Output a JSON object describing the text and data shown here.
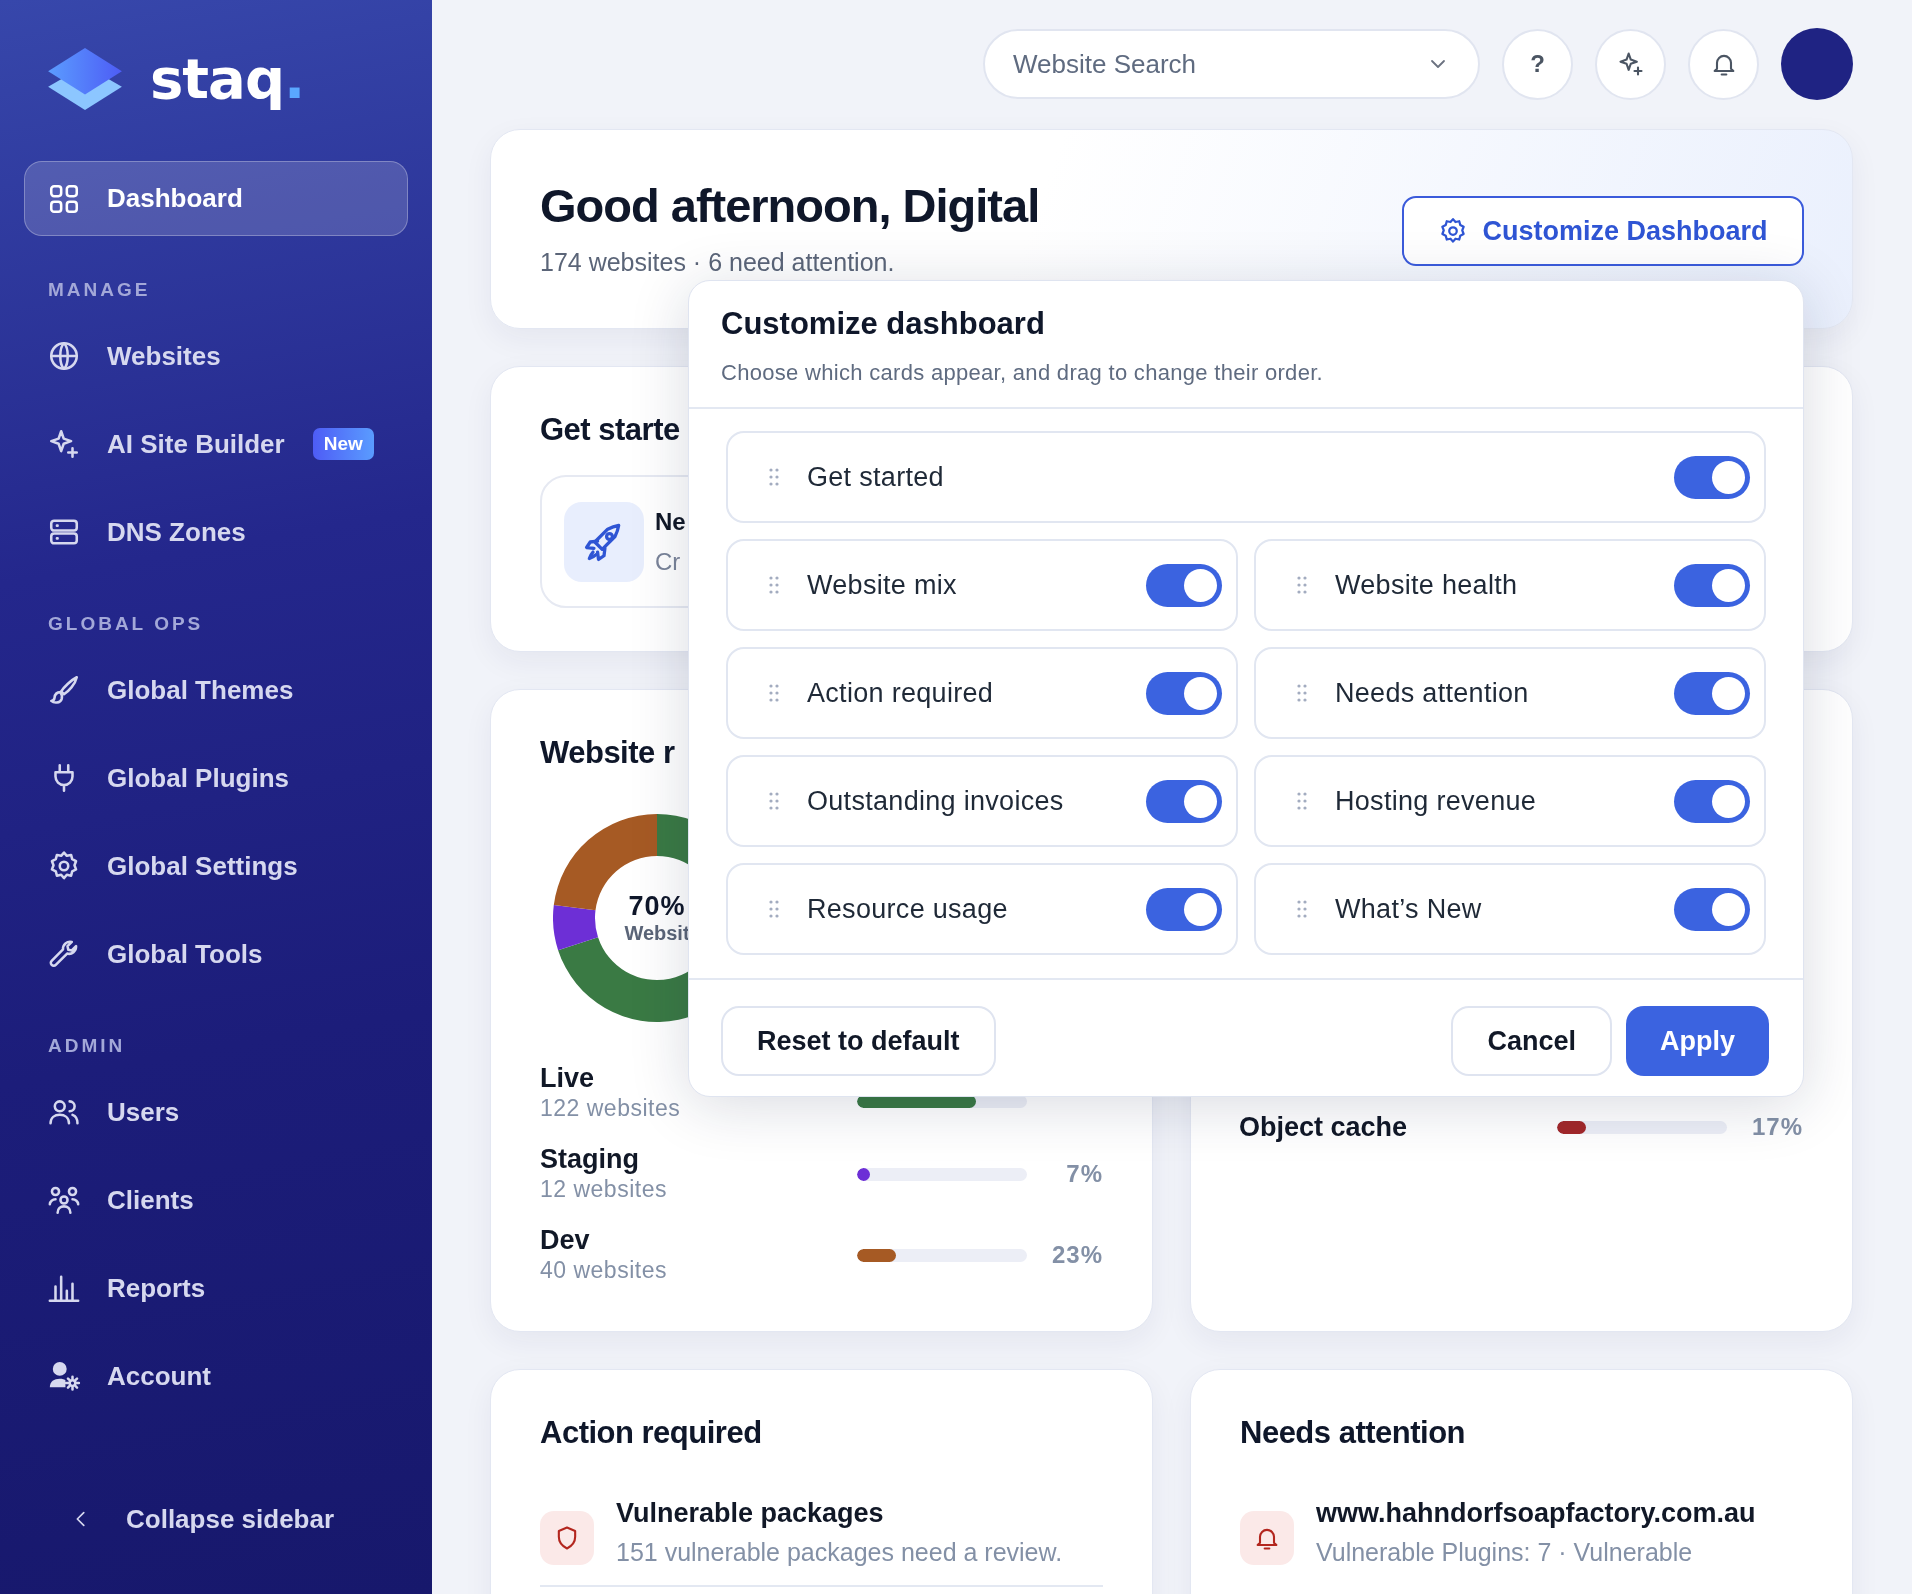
{
  "sidebar": {
    "brand": "staq",
    "brand_dot": ".",
    "nav": [
      {
        "kind": "item",
        "label": "Dashboard",
        "selected": true
      },
      {
        "kind": "section",
        "label": "MANAGE"
      },
      {
        "kind": "item",
        "label": "Websites",
        "selected": false
      },
      {
        "kind": "item",
        "label": "AI Site Builder",
        "selected": false,
        "badge": "New"
      },
      {
        "kind": "item",
        "label": "DNS Zones",
        "selected": false
      },
      {
        "kind": "section",
        "label": "GLOBAL OPS"
      },
      {
        "kind": "item",
        "label": "Global Themes",
        "selected": false
      },
      {
        "kind": "item",
        "label": "Global Plugins",
        "selected": false
      },
      {
        "kind": "item",
        "label": "Global Settings",
        "selected": false
      },
      {
        "kind": "item",
        "label": "Global Tools",
        "selected": false
      },
      {
        "kind": "section",
        "label": "ADMIN"
      },
      {
        "kind": "item",
        "label": "Users",
        "selected": false
      },
      {
        "kind": "item",
        "label": "Clients",
        "selected": false
      },
      {
        "kind": "item",
        "label": "Reports",
        "selected": false
      },
      {
        "kind": "item",
        "label": "Account",
        "selected": false
      }
    ],
    "collapse": "Collapse sidebar"
  },
  "topbar": {
    "search": {
      "placeholder": "Website Search"
    },
    "help": "?"
  },
  "greeting": {
    "title": "Good afternoon, Digital",
    "subtitle": "174 websites · 6 need attention.",
    "button": "Customize Dashboard"
  },
  "get_started": {
    "title": "Get starte",
    "tile": {
      "title": "Ne",
      "subtitle": "Cr"
    }
  },
  "website_mix": {
    "title": "Website r",
    "donut_value": "70%",
    "donut_label": "Websit",
    "rows": [
      {
        "name": "Live",
        "count": "122 websites",
        "level": 0.7,
        "color": "#3a7a44"
      },
      {
        "name": "Staging",
        "count": "12 websites",
        "level": 0.07,
        "color": "#6d2fd6",
        "percent": "7%"
      },
      {
        "name": "Dev",
        "count": "40 websites",
        "level": 0.23,
        "color": "#a65a24",
        "percent": "23%"
      }
    ]
  },
  "website_health": {
    "rows": [
      {
        "name": "Object cache",
        "level": 0.17,
        "color": "#a3282a",
        "percent": "17%"
      }
    ]
  },
  "action_required": {
    "title": "Action required",
    "items": [
      {
        "title": "Vulnerable packages",
        "text": "151 vulnerable packages need a review."
      }
    ]
  },
  "needs_attention": {
    "title": "Needs attention",
    "items": [
      {
        "title": "www.hahndorfsoapfactory.com.au",
        "text": "Vulnerable Plugins: 7 · Vulnerable"
      }
    ]
  },
  "modal": {
    "title": "Customize dashboard",
    "subtitle": "Choose which cards appear, and drag to change their order.",
    "cards": [
      {
        "label": "Get started",
        "on": true,
        "kind": "wide"
      },
      {
        "label": "Website mix",
        "on": true,
        "kind": "half"
      },
      {
        "label": "Website health",
        "on": true,
        "kind": "half"
      },
      {
        "label": "Action required",
        "on": true,
        "kind": "half"
      },
      {
        "label": "Needs attention",
        "on": true,
        "kind": "half"
      },
      {
        "label": "Outstanding invoices",
        "on": true,
        "kind": "half"
      },
      {
        "label": "Hosting revenue",
        "on": true,
        "kind": "half"
      },
      {
        "label": "Resource usage",
        "on": true,
        "kind": "half"
      },
      {
        "label": "What’s New",
        "on": true,
        "kind": "half"
      }
    ],
    "reset": "Reset to default",
    "cancel": "Cancel",
    "apply": "Apply"
  }
}
